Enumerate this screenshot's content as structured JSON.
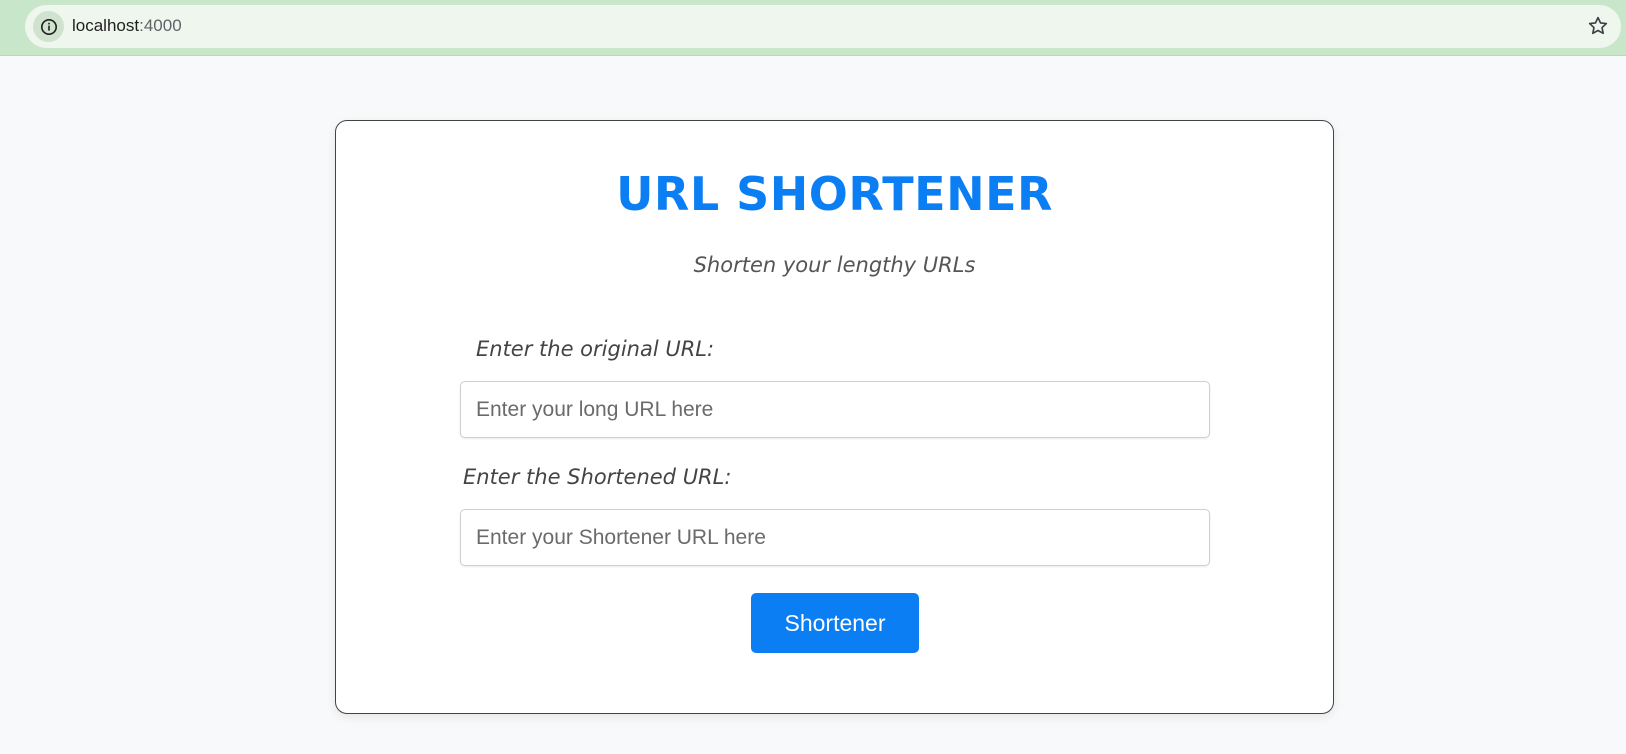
{
  "browser": {
    "url_host": "localhost",
    "url_port": ":4000",
    "site_info_icon": "info-icon",
    "bookmark_icon": "star-icon"
  },
  "app": {
    "title": "URL SHORTENER",
    "subtitle": "Shorten your lengthy URLs",
    "original_label": "Enter the original URL:",
    "original_value": "",
    "original_placeholder": "Enter your long URL here",
    "short_label": "Enter the Shortened URL:",
    "short_value": "",
    "short_placeholder": "Enter your Shortener URL here",
    "button_label": "Shortener"
  },
  "colors": {
    "accent": "#0b7ef3",
    "browser_bar": "#c8e6c9"
  }
}
